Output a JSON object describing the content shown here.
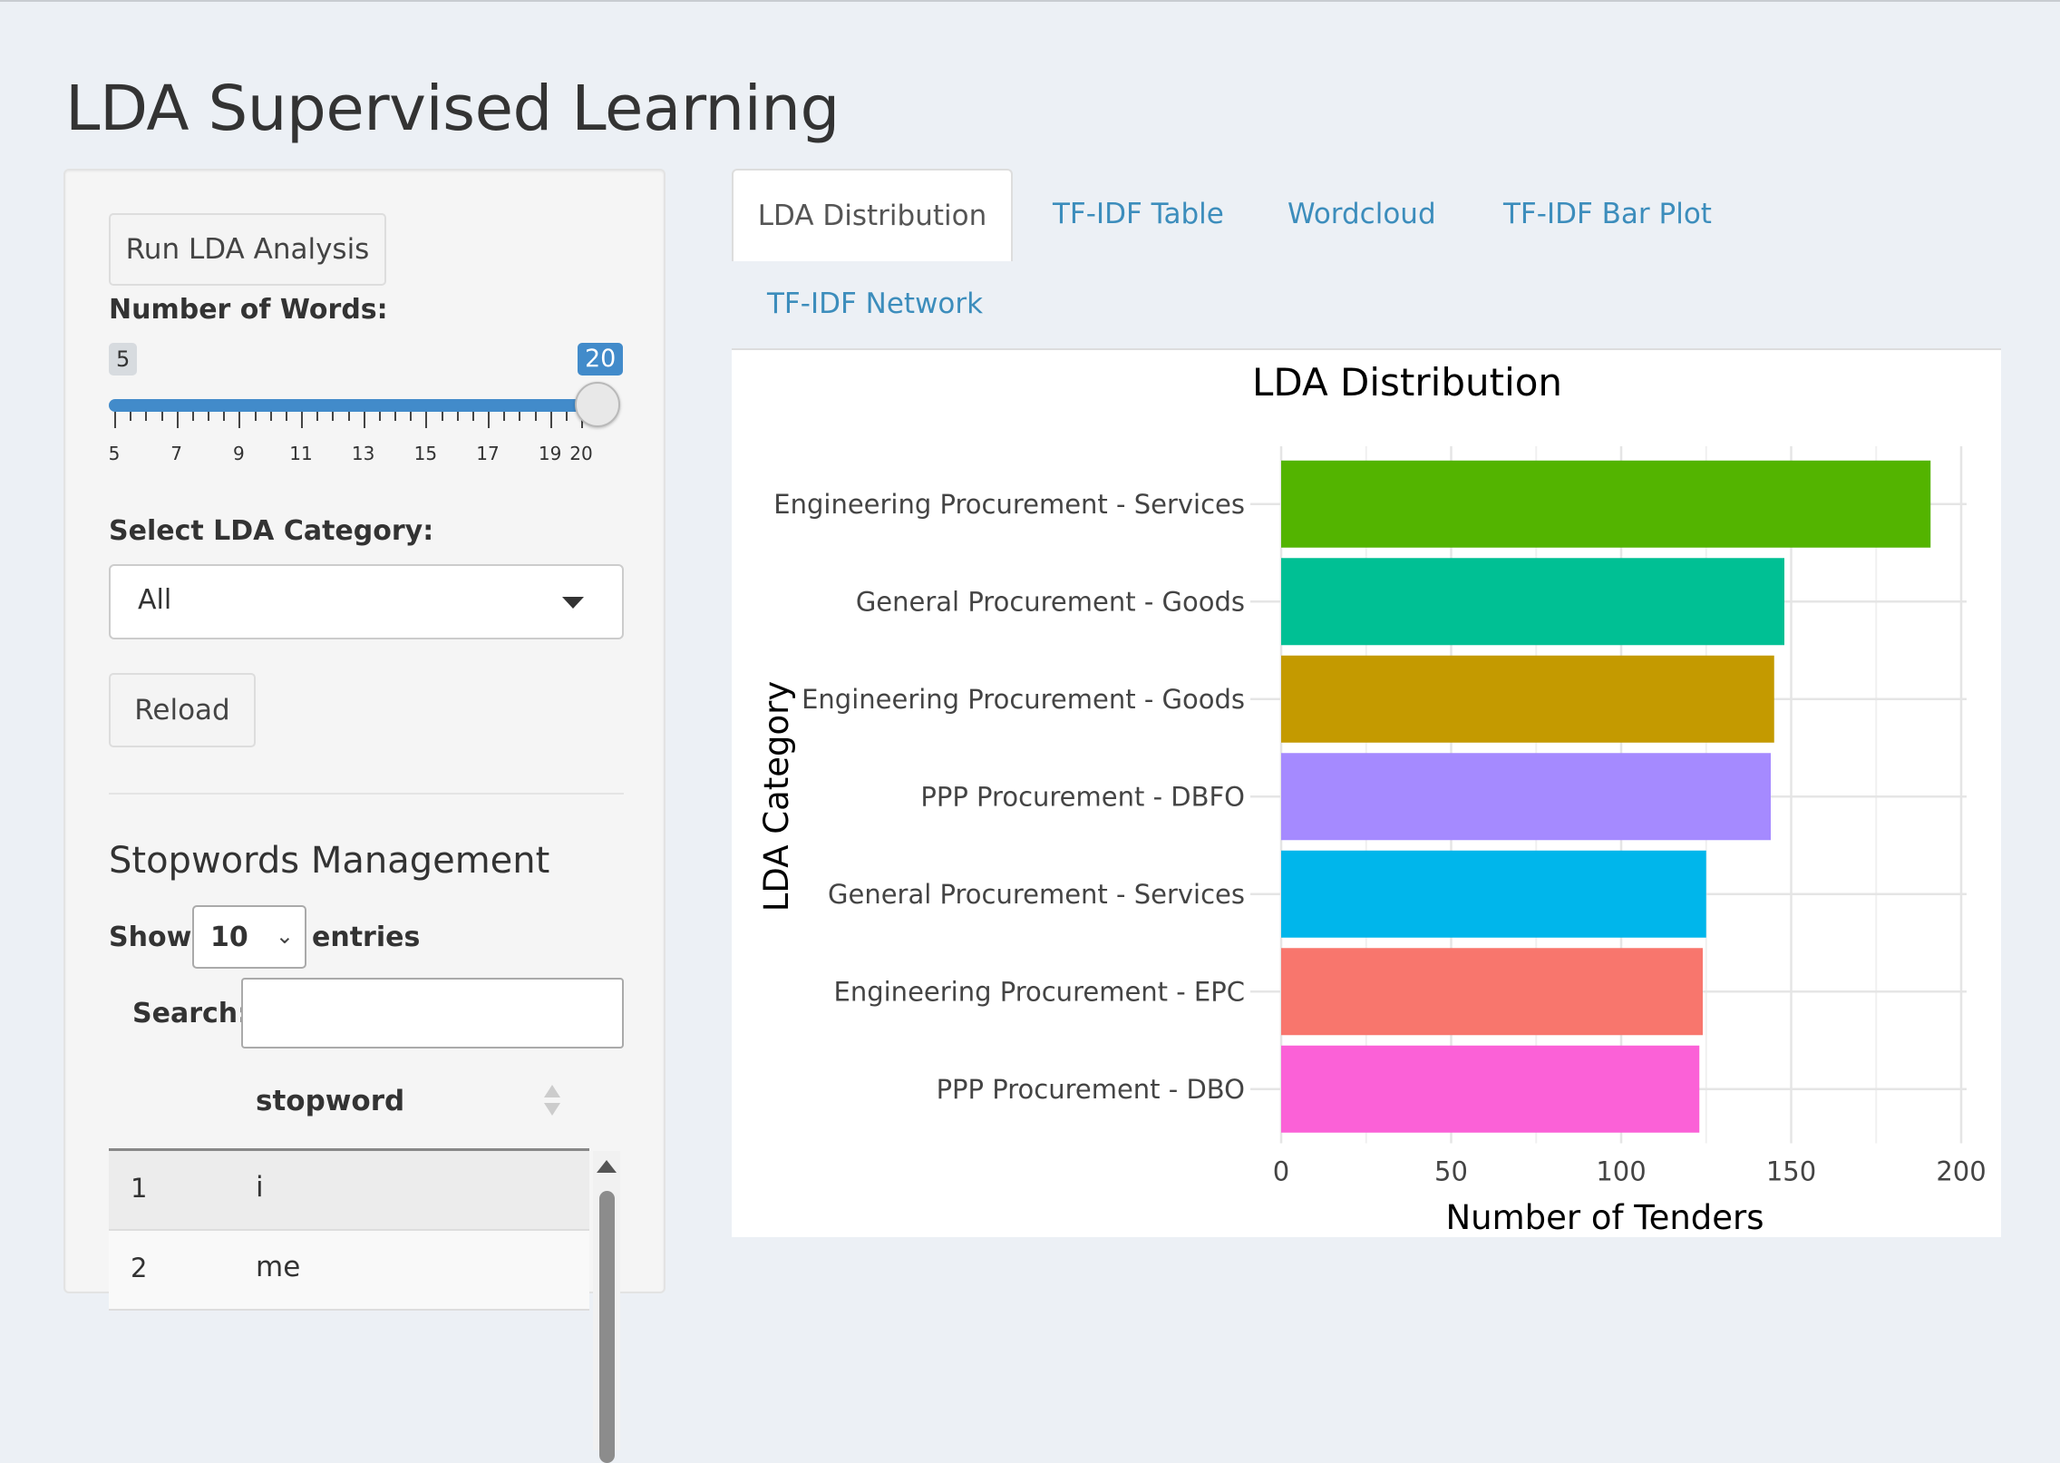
{
  "page": {
    "title": "LDA Supervised Learning"
  },
  "sidebar": {
    "run_button": "Run LDA Analysis",
    "words_label": "Number of Words:",
    "slider": {
      "min": 5,
      "max": 20,
      "value": 20,
      "min_badge": "5",
      "max_badge": "20",
      "tick_labels": [
        "5",
        "7",
        "9",
        "11",
        "13",
        "15",
        "17",
        "19",
        "20"
      ]
    },
    "category_label": "Select LDA Category:",
    "category_value": "All",
    "reload_button": "Reload",
    "stopwords_title": "Stopwords Management",
    "show_label": "Show",
    "entries_value": "10",
    "entries_label": "entries",
    "search_label": "Search:",
    "search_value": "",
    "table": {
      "column": "stopword",
      "rows": [
        {
          "index": "1",
          "word": "i"
        },
        {
          "index": "2",
          "word": "me"
        }
      ]
    }
  },
  "tabs": [
    {
      "label": "LDA Distribution",
      "active": true
    },
    {
      "label": "TF-IDF Table",
      "active": false
    },
    {
      "label": "Wordcloud",
      "active": false
    },
    {
      "label": "TF-IDF Bar Plot",
      "active": false
    },
    {
      "label": "TF-IDF Network",
      "active": false
    }
  ],
  "colors": {
    "accent": "#3c8dbc",
    "slider": "#428bca"
  },
  "chart_data": {
    "type": "bar",
    "orientation": "horizontal",
    "title": "LDA Distribution",
    "xlabel": "Number of Tenders",
    "ylabel": "LDA Category",
    "xlim": [
      0,
      200
    ],
    "x_ticks": [
      0,
      50,
      100,
      150,
      200
    ],
    "grid": true,
    "categories": [
      "Engineering Procurement - Services",
      "General Procurement - Goods",
      "Engineering Procurement - Goods",
      "PPP Procurement - DBFO",
      "General Procurement - Services",
      "Engineering Procurement - EPC",
      "PPP Procurement - DBO"
    ],
    "values": [
      191,
      148,
      145,
      144,
      125,
      124,
      123
    ],
    "colors": [
      "#53b400",
      "#00c094",
      "#c49a00",
      "#a58aff",
      "#00b6eb",
      "#f8766d",
      "#fb61d7"
    ]
  }
}
